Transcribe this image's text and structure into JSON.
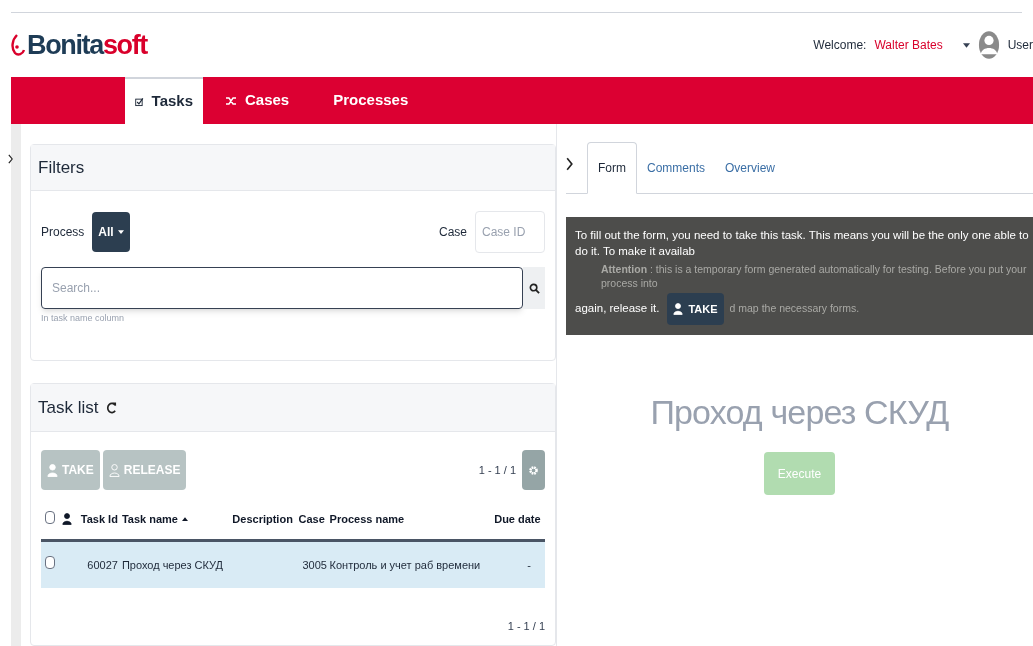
{
  "header": {
    "logo": {
      "first": "Bonita",
      "second": "soft"
    },
    "welcome_label": "Welcome:",
    "user_name": "Walter Bates",
    "user_label": "User"
  },
  "nav": [
    {
      "label": "Tasks",
      "kind": "tasks",
      "selected": true
    },
    {
      "label": "Cases",
      "kind": "cases",
      "selected": false
    },
    {
      "label": "Processes",
      "kind": "processes",
      "selected": false
    }
  ],
  "filters": {
    "title": "Filters",
    "process_label": "Process",
    "process_value": "All",
    "case_label": "Case",
    "case_placeholder": "Case ID",
    "search_placeholder": "Search...",
    "search_hint": "In task name column"
  },
  "task_list": {
    "title": "Task list",
    "buttons": [
      {
        "label": "TAKE",
        "kind": "take",
        "disabled": true
      },
      {
        "label": "RELEASE",
        "kind": "release",
        "disabled": true
      }
    ],
    "pagination_top": "1 - 1 / 1",
    "pagination_bottom": "1 - 1 / 1",
    "select_all_checked": false,
    "columns": [
      {
        "label": "Task Id",
        "sorted": false
      },
      {
        "label": "Task name",
        "sorted": true
      },
      {
        "label": "Description",
        "sorted": false
      },
      {
        "label": "Case",
        "sorted": false
      },
      {
        "label": "Process name",
        "sorted": false
      },
      {
        "label": "Due date",
        "sorted": false
      }
    ],
    "rows": [
      {
        "selected": true,
        "checked": false,
        "cells": [
          "60027",
          "Проход через СКУД",
          "",
          "3005",
          "Контроль и учет раб времени",
          "-"
        ]
      }
    ]
  },
  "detail": {
    "tabs": [
      {
        "label": "Form",
        "selected": true
      },
      {
        "label": "Comments",
        "selected": false
      },
      {
        "label": "Overview",
        "selected": false
      }
    ],
    "overlay": {
      "message": "To fill out the form, you need to take this task. This means you will be the only one able to do it. To make it availab",
      "message_end": "again, release it.",
      "take_button": "TAKE",
      "note_bold": "Attention",
      "note": " : this is a temporary form generated automatically for testing. Before you put your process into",
      "note_tail": "d map the necessary forms."
    },
    "form_title": "Проход через СКУД",
    "execute_button": {
      "label": "Execute",
      "disabled": true
    }
  }
}
